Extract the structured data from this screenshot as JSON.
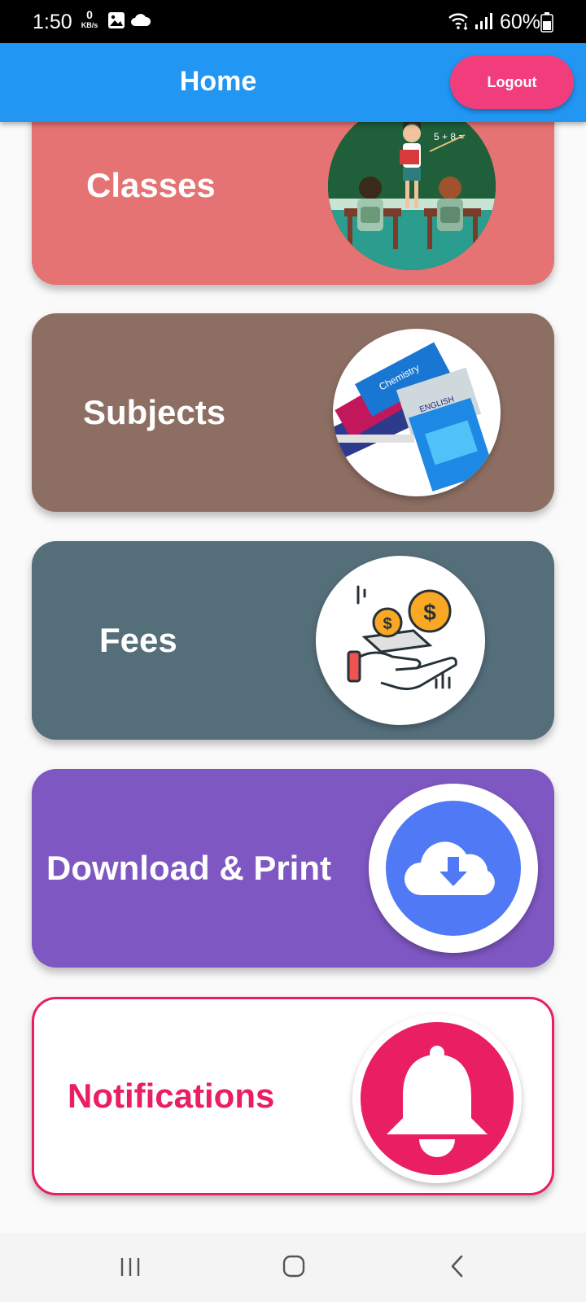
{
  "status_bar": {
    "time": "1:50",
    "kbs_value": "0",
    "kbs_unit": "KB/s",
    "battery": "60%"
  },
  "app_bar": {
    "title": "Home",
    "logout_label": "Logout"
  },
  "cards": {
    "classes": {
      "label": "Classes",
      "color": "#e57373",
      "image": "teacher-classroom-illustration"
    },
    "subjects": {
      "label": "Subjects",
      "color": "#8d6e63",
      "image": "textbooks-stack-photo"
    },
    "fees": {
      "label": "Fees",
      "color": "#546e7a",
      "image": "hand-with-coins-icon"
    },
    "download": {
      "label": "Download & Print",
      "color": "#7e57c2",
      "image": "cloud-download-icon"
    },
    "notifications": {
      "label": "Notifications",
      "color": "#e91e63",
      "image": "bell-icon"
    }
  },
  "nav_bar": {
    "items": [
      "recent-apps",
      "home",
      "back"
    ]
  }
}
